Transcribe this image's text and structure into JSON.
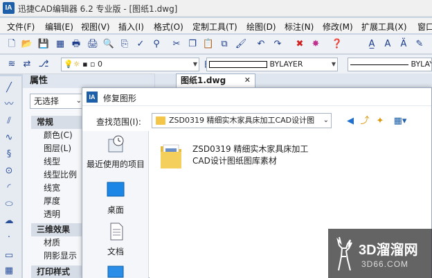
{
  "window": {
    "app_logo": "IA",
    "title": "迅捷CAD编辑器 6.2 专业版 - [图纸1.dwg]"
  },
  "menu": [
    "文件(F)",
    "编辑(E)",
    "视图(V)",
    "插入(I)",
    "格式(O)",
    "定制工具(T)",
    "绘图(D)",
    "标注(N)",
    "修改(M)",
    "扩展工具(X)",
    "窗口"
  ],
  "toolbar2": {
    "layer_value": "0",
    "color_value": "BYLAYER",
    "linetype_value": "BYLAY"
  },
  "properties": {
    "title": "属性",
    "selection": "无选择",
    "sections": [
      {
        "label": "常规",
        "rows": [
          "颜色(C)",
          "图层(L)",
          "线型",
          "线型比例",
          "线宽",
          "厚度",
          "透明"
        ]
      },
      {
        "label": "三维效果",
        "rows": [
          "材质",
          "阴影显示"
        ]
      },
      {
        "label": "打印样式",
        "rows": []
      }
    ]
  },
  "doc_tab": {
    "label": "图纸1.dwg",
    "close": "✕"
  },
  "dialog": {
    "logo": "IA",
    "title": "修复图形",
    "lookin_label": "查找范围(I):",
    "lookin_value": "ZSD0319  精细实木家具床加工CAD设计图",
    "places": [
      "最近使用的项目",
      "桌面",
      "文档"
    ],
    "file": {
      "line1": "ZSD0319  精细实木家具床加工",
      "line2": "CAD设计图纸图库素材"
    }
  },
  "watermark": {
    "big": "3D溜溜网",
    "small": "3D66.COM"
  },
  "colors": {
    "accent": "#1d5fa8",
    "folder": "#f3c548"
  }
}
